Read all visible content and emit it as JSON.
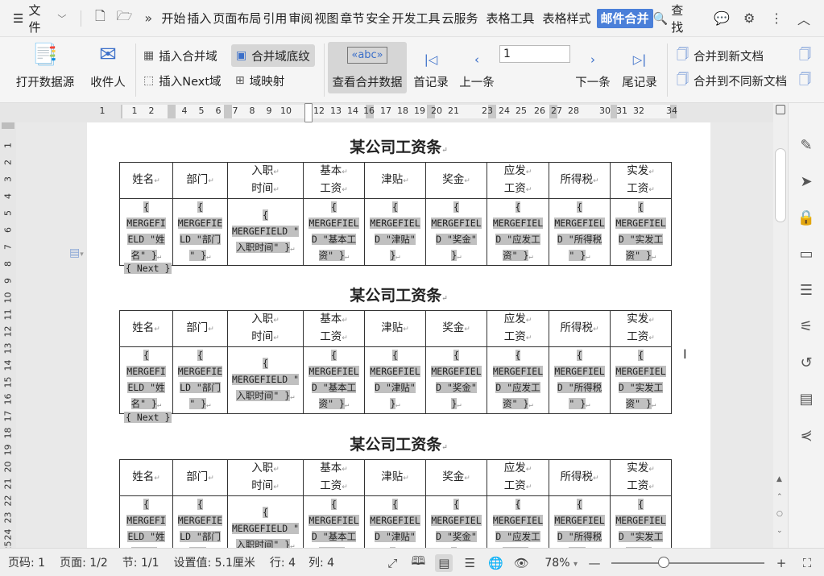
{
  "menubar": {
    "file_label": "文件",
    "tabs": [
      "开始",
      "插入",
      "页面布局",
      "引用",
      "审阅",
      "视图",
      "章节",
      "安全",
      "开发工具",
      "云服务"
    ],
    "context_tabs": [
      "表格工具",
      "表格样式"
    ],
    "active_tab": "邮件合并",
    "search_label": "查找"
  },
  "ribbon": {
    "open_datasource": "打开数据源",
    "recipients": "收件人",
    "insert_merge_field": "插入合并域",
    "merge_field_shading": "合并域底纹",
    "insert_next_field": "插入Next域",
    "field_mapping": "域映射",
    "view_merged_data": "查看合并数据",
    "first_record": "首记录",
    "prev_record": "上一条",
    "record_number": "1",
    "next_record": "下一条",
    "last_record": "尾记录",
    "merge_to_new_doc": "合并到新文档",
    "merge_to_diff_docs": "合并到不同新文档"
  },
  "ruler": {
    "numbers": [
      "1",
      "1",
      "2",
      "4",
      "5",
      "6",
      "7",
      "8",
      "9",
      "10",
      "12",
      "13",
      "14",
      "16",
      "17",
      "18",
      "19",
      "20",
      "21",
      "23",
      "24",
      "25",
      "26",
      "27",
      "28",
      "30",
      "31",
      "32",
      "34"
    ],
    "vnumbers": [
      "1",
      "2",
      "3",
      "4",
      "5",
      "6",
      "7",
      "8",
      "9",
      "10",
      "11",
      "12",
      "13",
      "14",
      "15",
      "16",
      "17",
      "18",
      "19",
      "20",
      "21",
      "22",
      "23",
      "24",
      "25"
    ]
  },
  "document": {
    "title": "某公司工资条",
    "headers": [
      [
        "姓名"
      ],
      [
        "部门"
      ],
      [
        "入职",
        "时间"
      ],
      [
        "基本",
        "工资"
      ],
      [
        "津贴"
      ],
      [
        "奖金"
      ],
      [
        "应发",
        "工资"
      ],
      [
        "所得税"
      ],
      [
        "实发",
        "工资"
      ]
    ],
    "fields": [
      [
        "{",
        "MERGEFI",
        "ELD \"姓",
        "名\" }"
      ],
      [
        "{",
        "MERGEFIE",
        "LD \"部门",
        "\" }"
      ],
      [
        "{",
        "MERGEFIELD \"",
        "入职时间\" }"
      ],
      [
        "{",
        "MERGEFIEL",
        "D \"基本工",
        "资\" }"
      ],
      [
        "{",
        "MERGEFIEL",
        "D \"津贴\"",
        "}"
      ],
      [
        "{",
        "MERGEFIEL",
        "D \"奖金\"",
        "}"
      ],
      [
        "{",
        "MERGEFIEL",
        "D \"应发工",
        "资\" }"
      ],
      [
        "{",
        "MERGEFIEL",
        "D \"所得税",
        "\" }"
      ],
      [
        "{",
        "MERGEFIEL",
        "D \"实发工",
        "资\" }"
      ]
    ],
    "next_field": "{ Next }"
  },
  "status": {
    "page_no": "页码: 1",
    "pages": "页面: 1/2",
    "section": "节: 1/1",
    "setting": "设置值: 5.1厘米",
    "row": "行: 4",
    "col": "列: 4",
    "zoom": "78%"
  }
}
